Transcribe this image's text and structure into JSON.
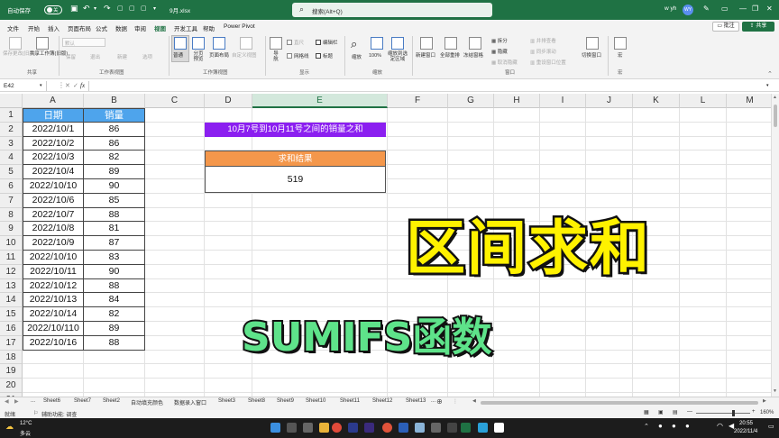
{
  "titlebar": {
    "autosave_label": "自动保存",
    "autosave_state": "关",
    "filename": "9月.xlsx",
    "search_placeholder": "搜索(Alt+Q)",
    "user": "w yh",
    "avatar": "WY",
    "color": "#1f7244"
  },
  "menu": {
    "items": [
      "文件",
      "开始",
      "插入",
      "页面布局",
      "公式",
      "数据",
      "审阅",
      "视图",
      "开发工具",
      "帮助",
      "Power Pivot"
    ],
    "active": "视图",
    "comment_label": "批注",
    "share_label": "共享"
  },
  "ribbon": {
    "share_group": {
      "label": "共享",
      "buttons": [
        "保存更改(旧版)",
        "共享工作簿(旧版)"
      ]
    },
    "sheetview_group": {
      "label": "工作表视图",
      "default_value": "默认",
      "buttons": [
        "保留",
        "退出",
        "新建",
        "选项"
      ]
    },
    "workbookview_group": {
      "label": "工作簿视图",
      "buttons": [
        "普通",
        "分页预览",
        "页面布局",
        "自定义视图"
      ]
    },
    "show_group": {
      "label": "显示",
      "buttons": [
        "导航"
      ],
      "checkboxes": [
        {
          "label": "直尺",
          "checked": true,
          "enabled": false
        },
        {
          "label": "编辑栏",
          "checked": true,
          "enabled": true
        },
        {
          "label": "网格线",
          "checked": false,
          "enabled": true
        },
        {
          "label": "标题",
          "checked": true,
          "enabled": true
        }
      ]
    },
    "zoom_group": {
      "label": "缩放",
      "buttons": [
        "缩放",
        "100%",
        "缩放到选定区域"
      ]
    },
    "window_group": {
      "label": "窗口",
      "buttons": [
        "新建窗口",
        "全部重排",
        "冻结窗格"
      ],
      "small": [
        "拆分",
        "隐藏",
        "取消隐藏"
      ],
      "small_dim": [
        "并排查看",
        "同步滚动",
        "重设窗口位置"
      ],
      "switch": "切换窗口"
    },
    "macro_group": {
      "label": "宏",
      "buttons": [
        "宏"
      ]
    }
  },
  "formulabar": {
    "namebox": "E42",
    "fx": "fx",
    "formula": ""
  },
  "columns": [
    "A",
    "B",
    "C",
    "D",
    "E",
    "F",
    "G",
    "H",
    "I",
    "J",
    "K",
    "L",
    "M"
  ],
  "selected_column": "E",
  "rows": [
    "1",
    "2",
    "3",
    "4",
    "5",
    "6",
    "7",
    "8",
    "9",
    "10",
    "11",
    "12",
    "13",
    "14",
    "15",
    "16",
    "17",
    "18",
    "19",
    "20",
    "21"
  ],
  "table": {
    "headers": [
      "日期",
      "销量"
    ],
    "rows": [
      [
        "2022/10/1",
        "86"
      ],
      [
        "2022/10/2",
        "86"
      ],
      [
        "2022/10/3",
        "82"
      ],
      [
        "2022/10/4",
        "89"
      ],
      [
        "2022/10/10",
        "90"
      ],
      [
        "2022/10/6",
        "85"
      ],
      [
        "2022/10/7",
        "88"
      ],
      [
        "2022/10/8",
        "81"
      ],
      [
        "2022/10/9",
        "87"
      ],
      [
        "2022/10/10",
        "83"
      ],
      [
        "2022/10/11",
        "90"
      ],
      [
        "2022/10/12",
        "88"
      ],
      [
        "2022/10/13",
        "84"
      ],
      [
        "2022/10/14",
        "82"
      ],
      [
        "2022/10/110",
        "89"
      ],
      [
        "2022/10/16",
        "88"
      ]
    ],
    "header_color": "#4ea4ec"
  },
  "question": {
    "text": "10月7号到10月11号之间的销量之和",
    "color": "#8b1ff0"
  },
  "result": {
    "header": "求和结果",
    "value": "519",
    "header_color": "#f4974b"
  },
  "overlay": {
    "title": "区间求和",
    "subtitle": "SUMIFS函数",
    "title_color": "#fff200",
    "subtitle_color": "#5ee38a"
  },
  "sheets": [
    "...",
    "Sheet6",
    "Sheet7",
    "Sheet2",
    "自动填充颜色",
    "数据录入窗口",
    "Sheet3",
    "Sheet8",
    "Sheet9",
    "Sheet10",
    "Sheet11",
    "Sheet12",
    "Sheet13",
    "..."
  ],
  "status": {
    "ready": "就绪",
    "accessibility": "辅助功能: 调查",
    "zoom": "160%"
  },
  "taskbar": {
    "temp": "12°C",
    "weather": "多云",
    "time": "20:55",
    "date": "2022/11/4"
  }
}
